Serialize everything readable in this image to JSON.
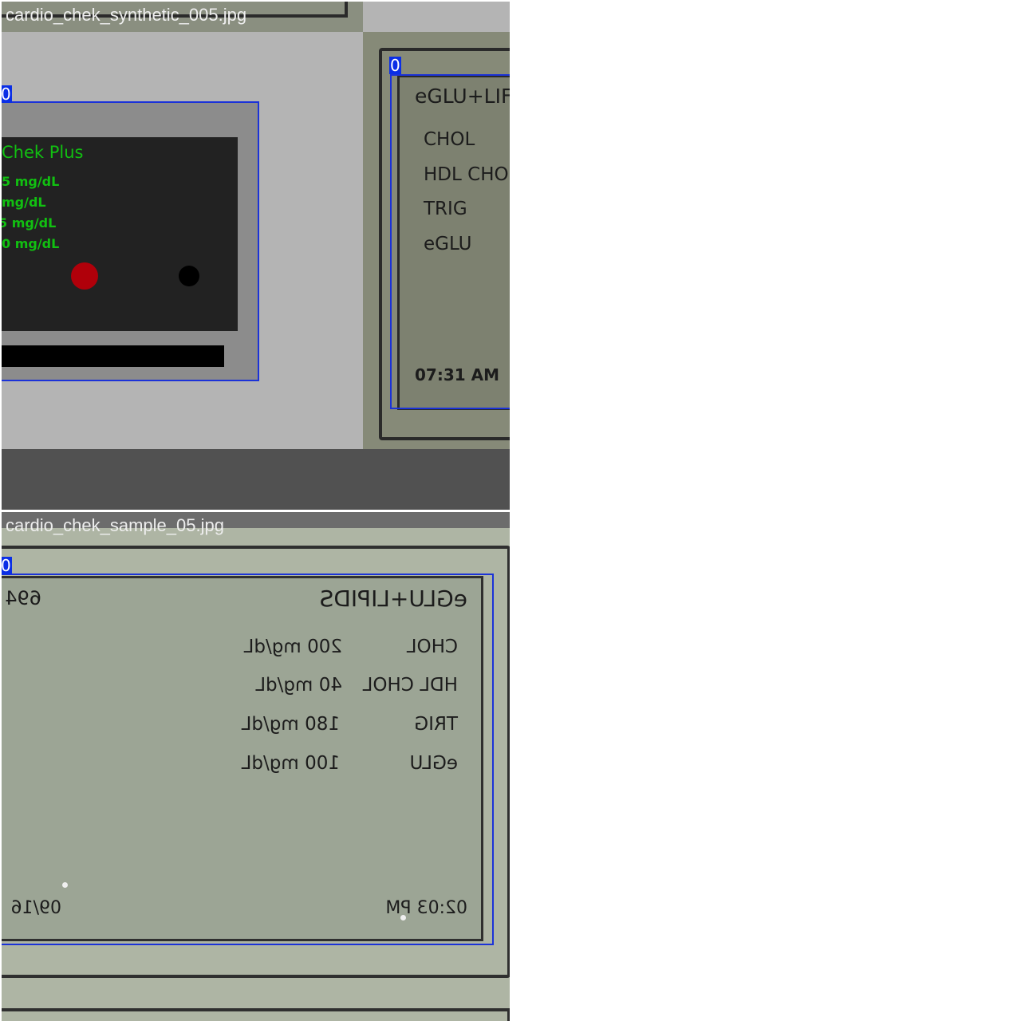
{
  "tiles": [
    {
      "filename": "cardio_chek_synthetic_005.jpg",
      "left_device": {
        "title": "Chek Plus",
        "readings": [
          "5 mg/dL",
          "mg/dL",
          "5 mg/dL",
          "0 mg/dL"
        ]
      },
      "right_device": {
        "title": "eGLU+LIF",
        "labels": [
          "CHOL",
          "HDL CHO",
          "TRIG",
          "eGLU"
        ],
        "time": "07:31 AM"
      },
      "boxes": [
        {
          "class": "0"
        },
        {
          "class": "0"
        }
      ]
    },
    {
      "filename": "cardio_chek_sample_05.jpg",
      "mirrored": true,
      "title": "eGLU+LIPIDS",
      "id_fragment": "694",
      "rows": [
        {
          "label": "CHOL",
          "value": "200 mg/dL"
        },
        {
          "label": "HDL CHOL",
          "value": "40 mg/dL"
        },
        {
          "label": "TRIG",
          "value": "180 mg/dL"
        },
        {
          "label": "eGLU",
          "value": "100 mg/dL"
        }
      ],
      "time": "02:03 PM",
      "date_fragment": "09/16",
      "boxes": [
        {
          "class": "0"
        }
      ]
    }
  ]
}
